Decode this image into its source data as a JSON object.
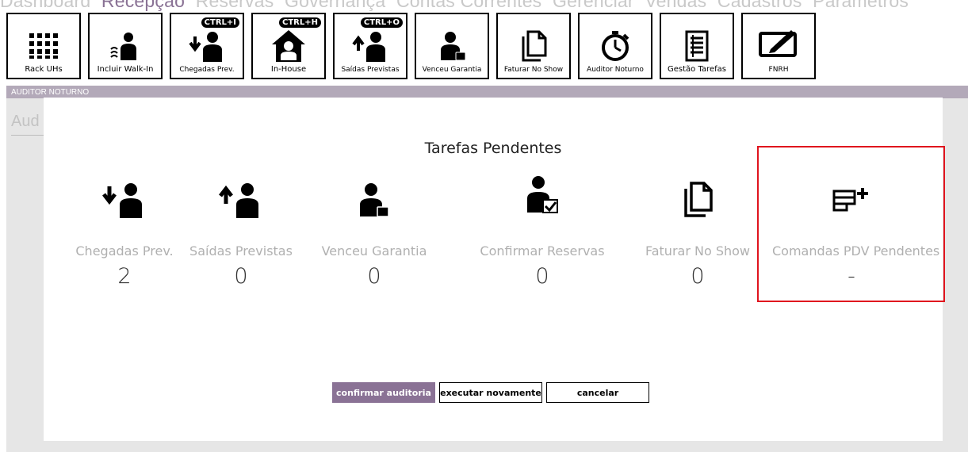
{
  "nav": {
    "items": [
      "Dashboard",
      "Recepção",
      "Reservas",
      "Governança",
      "Contas Correntes",
      "Gerenciar",
      "Vendas",
      "Cadastros",
      "Parâmetros"
    ],
    "active": "Recepção"
  },
  "toolbar": {
    "rack_label": "Rack UHs",
    "walkin_label": "Incluir Walk-In",
    "chegadas_label": "Chegadas Prev.",
    "chegadas_shortcut": "CTRL+I",
    "inhouse_label": "In-House",
    "inhouse_shortcut": "CTRL+H",
    "saidas_label": "Saídas Previstas",
    "saidas_shortcut": "CTRL+O",
    "venceu_label": "Venceu Garantia",
    "noshow_label": "Faturar No Show",
    "auditor_label": "Auditor Noturno",
    "gestao_label": "Gestão Tarefas",
    "fnrh_label": "FNRH"
  },
  "auditor": {
    "bar_title": "AUDITOR NOTURNO",
    "field_text": "Aud"
  },
  "modal": {
    "title": "Tarefas Pendentes",
    "tasks": [
      {
        "label": "Chegadas Prev.",
        "value": "2"
      },
      {
        "label": "Saídas Previstas",
        "value": "0"
      },
      {
        "label": "Venceu Garantia",
        "value": "0"
      },
      {
        "label": "Confirmar Reservas",
        "value": "0"
      },
      {
        "label": "Faturar No Show",
        "value": "0"
      },
      {
        "label": "Comandas PDV Pendentes",
        "value": "-"
      }
    ],
    "buttons": {
      "confirm": "confirmar auditoria",
      "rerun": "executar novamente",
      "cancel": "cancelar"
    }
  },
  "colors": {
    "accent": "#8a7295",
    "highlight": "#e0141e"
  }
}
